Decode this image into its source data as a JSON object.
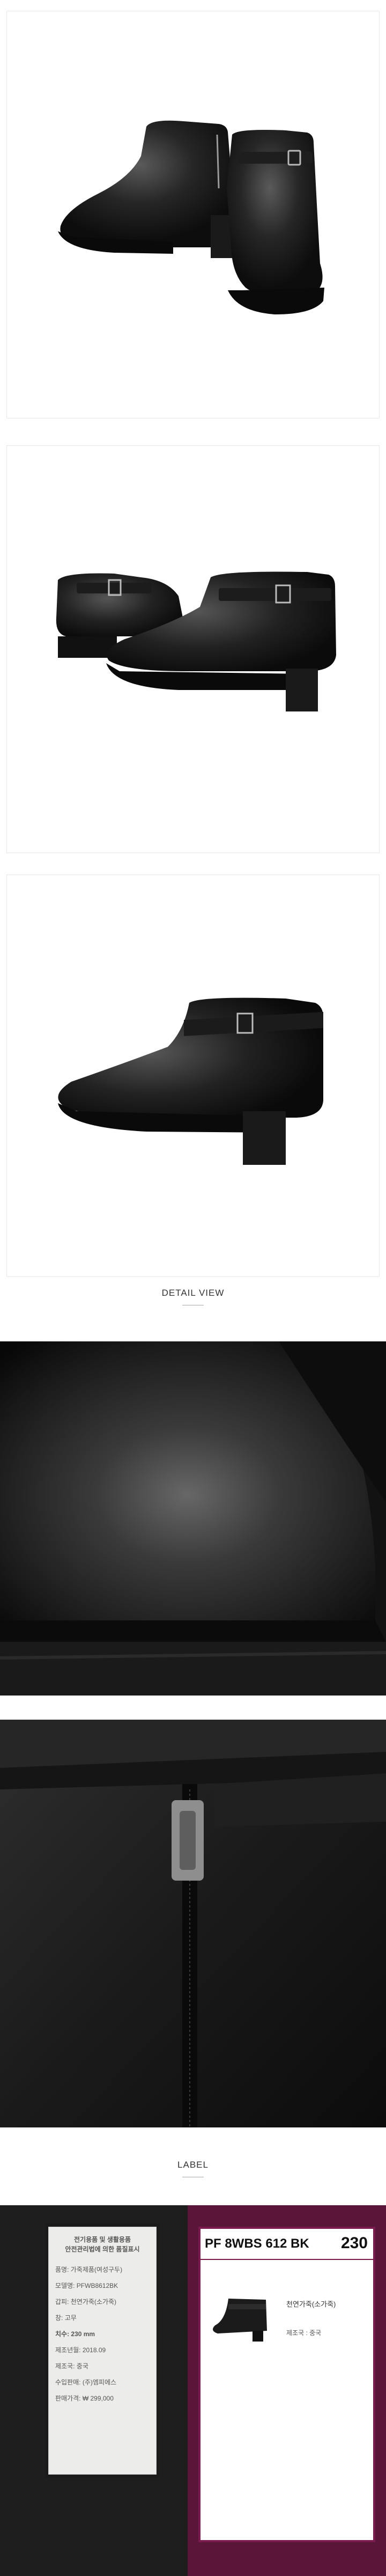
{
  "sections": {
    "detail_title": "DETAIL VIEW",
    "label_title": "LABEL"
  },
  "product": {
    "description": "Black leather ankle boots with side zipper and buckle strap"
  },
  "label_tag": {
    "heading_line1": "전기용품 및 생활용품",
    "heading_line2": "안전관리법에 의한 품질표시",
    "rows": [
      "품명: 가죽제품(여성구두)",
      "모델명: PFWB8612BK",
      "갑피: 천연가죽(소가죽)",
      "창: 고무",
      "치수: 230 mm",
      "제조년월: 2018.09",
      "제조국: 중국",
      "수입판매: (주)엠피에스",
      "판매가격: ₩ 299,000"
    ]
  },
  "box_label": {
    "code": "PF 8WBS 612 BK",
    "size": "230",
    "material": "천연가죽(소가죽)",
    "origin": "제조국 : 중국"
  }
}
